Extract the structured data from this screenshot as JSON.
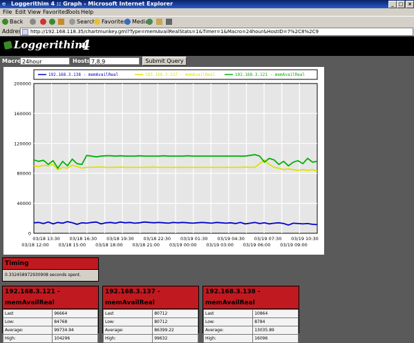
{
  "window": {
    "title": "Loggerithim 4 :: Graph - Microsoft Internet Explorer",
    "controls": [
      "_",
      "□",
      "×"
    ]
  },
  "menu": [
    "File",
    "Edit",
    "View",
    "Favorites",
    "Tools",
    "Help"
  ],
  "toolbar": {
    "back": "Back",
    "search": "Search",
    "favorites": "Favorites",
    "media": "Media"
  },
  "address": {
    "label": "Address",
    "url": "http://192.168.118.35/chartmunkey.gml?Type=memAvailRealStats=1&Timer=1&Macro=24hour&HostID=7%2C8%2C9"
  },
  "app": {
    "logo_text": "Loggerithim",
    "logo_num": "4"
  },
  "form": {
    "macro_label": "Macro:",
    "macro_value": "24hour",
    "hosts_label": "Hosts:",
    "hosts_value": "7,8,9",
    "submit_label": "Submit Query"
  },
  "chart_data": {
    "type": "line",
    "ylim": [
      0,
      200000
    ],
    "yticks": [
      "200000",
      "160000",
      "120000",
      "80000",
      "40000",
      "0"
    ],
    "xlabels_row1": [
      "03/18 13:30",
      "03/18 16:30",
      "03/18 19:30",
      "03/18 22:30",
      "03/19 01:30",
      "03/19 04:30",
      "03/19 07:30",
      "03/19 10:30"
    ],
    "xlabels_row2": [
      "03/18 12:00",
      "03/18 15:00",
      "03/18 18:00",
      "03/18 21:00",
      "03/19 00:00",
      "03/19 03:00",
      "03/19 06:00",
      "03/19 09:00"
    ],
    "series": [
      {
        "name": "192.168.3.138 - memAvailReal",
        "color": "#0000cc",
        "values": [
          14000,
          14500,
          13000,
          15000,
          12500,
          14500,
          13500,
          15500,
          14000,
          12000,
          14000,
          13500,
          14500,
          15000,
          12500,
          14000,
          14500,
          13500,
          15000,
          14000,
          14500,
          13500,
          14000,
          15000,
          14500,
          14000,
          14500,
          14000,
          13500,
          14500,
          14000,
          14500,
          14000,
          13500,
          14000,
          14500,
          14000,
          13500,
          14500,
          14000,
          13500,
          14000,
          13000,
          14500,
          12500,
          13500,
          14500,
          13000,
          14000,
          12500,
          13500,
          14000,
          13000,
          11000,
          13500,
          13000,
          12500,
          13000,
          12000,
          11500
        ]
      },
      {
        "name": "192.168.3.137 - memAvailReal",
        "color": "#e0e000",
        "values": [
          90000,
          89000,
          91000,
          90000,
          92000,
          85000,
          88000,
          87000,
          91000,
          89000,
          87000,
          88000,
          88000,
          88500,
          88500,
          88000,
          88000,
          88000,
          88500,
          88000,
          88000,
          88000,
          88000,
          88000,
          88000,
          88500,
          88000,
          88000,
          88000,
          88000,
          88000,
          88000,
          88000,
          88000,
          88000,
          88000,
          88000,
          88000,
          88000,
          88000,
          88000,
          88000,
          88000,
          88000,
          88500,
          88000,
          88000,
          93000,
          98000,
          92000,
          88000,
          87000,
          85000,
          86000,
          85000,
          84000,
          85000,
          84000,
          85000,
          83000
        ]
      },
      {
        "name": "192.168.3.121 - memAvailReal",
        "color": "#00b000",
        "values": [
          98000,
          96000,
          97500,
          92000,
          97000,
          87000,
          96000,
          90000,
          99000,
          93000,
          92000,
          104000,
          103000,
          102000,
          103000,
          103500,
          103500,
          103000,
          103500,
          103000,
          103000,
          103000,
          103500,
          103000,
          103000,
          103000,
          103000,
          103500,
          103000,
          103000,
          103000,
          103000,
          103500,
          103000,
          103000,
          103000,
          103000,
          103000,
          103000,
          103000,
          103000,
          103000,
          103000,
          103000,
          103000,
          104000,
          105000,
          103000,
          95000,
          100000,
          98000,
          92000,
          96000,
          90000,
          95000,
          97000,
          93000,
          100000,
          95000,
          96000
        ]
      }
    ]
  },
  "timing": {
    "title": "Timing",
    "text": "0.332458972930908 seconds spent."
  },
  "stats": [
    {
      "title": "192.168.3.121 - memAvailReal",
      "rows": [
        [
          "Last",
          "96664"
        ],
        [
          "Low:",
          "84768"
        ],
        [
          "Average:",
          "99734.94"
        ],
        [
          "High:",
          "104296"
        ]
      ]
    },
    {
      "title": "192.168.3.137 - memAvailReal",
      "rows": [
        [
          "Last",
          "80712"
        ],
        [
          "Low:",
          "80712"
        ],
        [
          "Average:",
          "86399.22"
        ],
        [
          "High:",
          "99632"
        ]
      ]
    },
    {
      "title": "192.168.3.138 - memAvailReal",
      "rows": [
        [
          "Last",
          "10864"
        ],
        [
          "Low:",
          "8784"
        ],
        [
          "Average:",
          "13035.89"
        ],
        [
          "High:",
          "16096"
        ]
      ]
    }
  ]
}
